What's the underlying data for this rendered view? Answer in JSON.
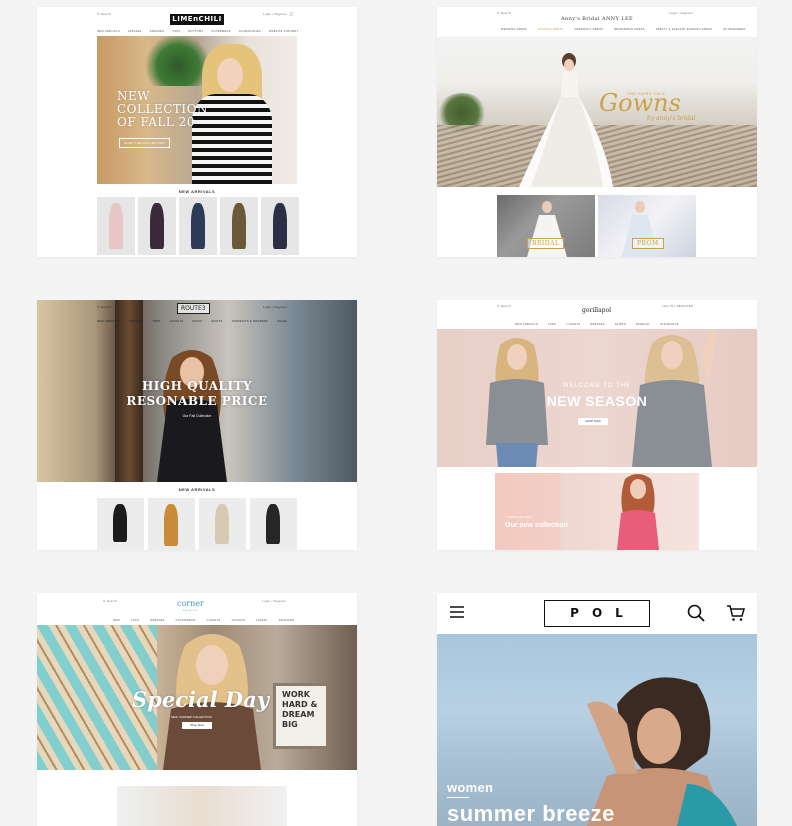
{
  "cards": [
    {
      "header": {
        "search": "Search",
        "logo": "LIMEnCHILI",
        "account": "Login / Register"
      },
      "menu": [
        "NEW ARRIVALS",
        "APPAREL",
        "DRESSES",
        "TOPS",
        "BOTTOMS",
        "OUTERWEAR",
        "ACCESSORIES",
        "WEBSITE CONTENT"
      ],
      "hero": {
        "line1": "NEW",
        "line2": "COLLECTION",
        "line3": "OF FALL 20",
        "button": "SHOP THE COLLECTION"
      },
      "section_title": "NEW ARRIVALS"
    },
    {
      "header": {
        "search": "Search",
        "logo": "Anny's Bridal  ANNY LEE",
        "account": "Login / Register"
      },
      "menu": [
        "WEDDING DRESS",
        "EVENING DRESS",
        "CEREMONY DRESS",
        "BRIDESMAID DRESS",
        "PRETTY & ELEGANT EVENING DRESS",
        "QUINCEANERA"
      ],
      "hero": {
        "top": "THE FAIRY TALE",
        "title": "Gowns",
        "by": "by anny's bridal"
      },
      "tiles": [
        "BRIDAL",
        "PROM"
      ]
    },
    {
      "header": {
        "search": "Search",
        "logo": "ROUTE3",
        "account": "Login / Register"
      },
      "menu": [
        "NEW ARRIVALS",
        "DRESSES",
        "TOPS",
        "JACKETS",
        "PANTS",
        "SKIRTS",
        "JUMPSUITS & ROMPERS",
        "SALES"
      ],
      "hero": {
        "line1": "HIGH QUALITY",
        "line2": "RESONABLE PRICE",
        "subtitle": "Our Fall Collection"
      },
      "section_title": "NEW ARRIVALS"
    },
    {
      "header": {
        "search": "Search",
        "logo": "gorillapol",
        "account": "LOG IN  |  REGISTER"
      },
      "menu": [
        "NEW ARRIVALS",
        "TOPS",
        "T-SHIRTS",
        "DRESSES",
        "SKIRTS",
        "JEWELRY",
        "CLEARANCE"
      ],
      "hero": {
        "line1": "WELCOME TO THE",
        "line2": "NEW SEASON",
        "button": "SHOP NOW"
      },
      "banner": {
        "small": "Fall/Summer 2017",
        "title": "Our new collection"
      }
    },
    {
      "header": {
        "search": "Search",
        "logo": "corner",
        "logo_sub": "FASHION",
        "account": "Login / Register"
      },
      "menu": [
        "NEW",
        "TOPS",
        "DRESSES",
        "OUTERWEAR",
        "T-SHIRTS",
        "JACKETS",
        "LATEST",
        "SALE/NEW"
      ],
      "hero": {
        "script": "Special Day",
        "subtitle": "NEW CORNER COLLECTION",
        "button": "Shop Now",
        "frame": "WORK HARD & DREAM BIG"
      }
    },
    {
      "header": {
        "logo": "POL",
        "menu_icon": "hamburger-icon",
        "search_icon": "search-icon",
        "cart_icon": "cart-icon"
      },
      "hero": {
        "label": "women",
        "title": "summer breeze"
      }
    }
  ]
}
